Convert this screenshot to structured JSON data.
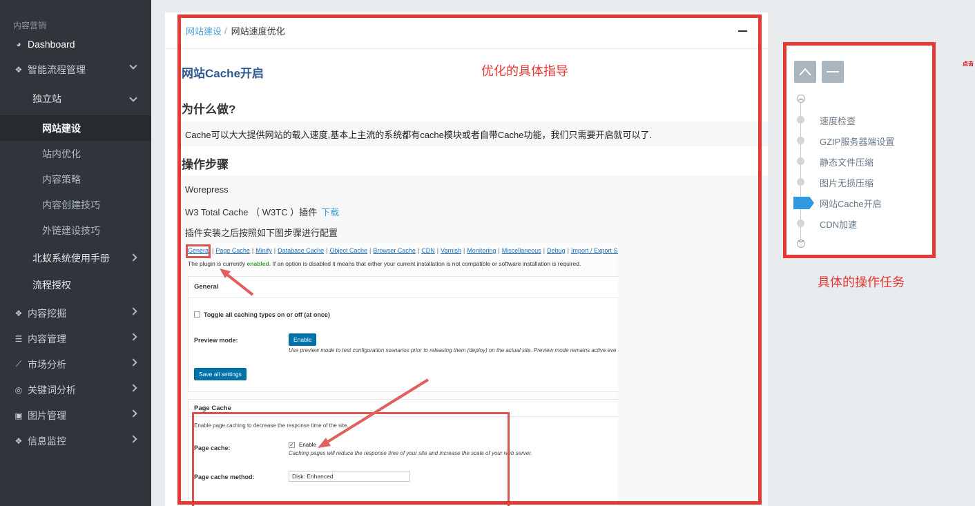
{
  "sidebar": {
    "section_title": "内容营销",
    "items": [
      {
        "label": "Dashboard",
        "icon": "dashboard-icon"
      },
      {
        "label": "智能流程管理",
        "icon": "cubes-icon"
      },
      {
        "label": "独立站"
      },
      {
        "label": "网站建设"
      },
      {
        "label": "站内优化"
      },
      {
        "label": "内容策略"
      },
      {
        "label": "内容创建技巧"
      },
      {
        "label": "外链建设技巧"
      },
      {
        "label": "北蚁系统使用手册"
      },
      {
        "label": "流程授权"
      },
      {
        "label": "内容挖掘",
        "icon": "cubes-icon"
      },
      {
        "label": "内容管理",
        "icon": "list-icon"
      },
      {
        "label": "市场分析",
        "icon": "chart-icon"
      },
      {
        "label": "关键词分析",
        "icon": "target-icon"
      },
      {
        "label": "图片管理",
        "icon": "image-icon"
      },
      {
        "label": "信息监控",
        "icon": "cubes-icon"
      }
    ]
  },
  "breadcrumb": {
    "parent": "网站建设",
    "separator": "/",
    "current": "网站速度优化"
  },
  "content": {
    "title": "网站Cache开启",
    "why_heading": "为什么做?",
    "why_text": "Cache可以大大提供网站的载入速度,基本上主流的系统都有cache模块或者自带Cache功能，我们只需要开启就可以了.",
    "steps_heading": "操作步骤",
    "step1": "Worepress",
    "step2": "W3 Total Cache （ W3TC ）插件",
    "step2_link": "下载",
    "step3": "插件安装之后按照如下图步骤进行配置"
  },
  "screenshot": {
    "tabs": [
      "General",
      "Page Cache",
      "Minify",
      "Database Cache",
      "Object Cache",
      "Browser Cache",
      "CDN",
      "Varnish",
      "Monitoring",
      "Miscellaneous",
      "Debug",
      "Import / Export Settings"
    ],
    "note_pre": "The plugin is currently",
    "note_bold": "enabled.",
    "note_post": "If an option is disabled it means that either your current installation is not compatible or software installation is required.",
    "general_title": "General",
    "toggle_label": "Toggle all caching types on or off (at once)",
    "preview_label": "Preview mode:",
    "enable_btn": "Enable",
    "preview_desc": "Use preview mode to test configuration scenarios prior to releasing them (deploy) on the actual site. Preview mode remains active eve",
    "save_btn": "Save all settings",
    "pc_title": "Page Cache",
    "pc_desc": "Enable page caching to decrease the response time of the site.",
    "pc_label": "Page cache:",
    "pc_enable": "Enable",
    "pc_enable_desc": "Caching pages will reduce the response time of your site and increase the scale of your web server.",
    "pc_method_label": "Page cache method:",
    "pc_method_value": "Disk: Enhanced"
  },
  "annotations": {
    "guide": "优化的具体指导",
    "tasks": "具体的操作任务"
  },
  "tasks": {
    "items": [
      "速度检查",
      "GZIP服务器端设置",
      "静态文件压缩",
      "图片无损压缩",
      "网站Cache开启",
      "CDN加速"
    ],
    "active_index": 4
  },
  "corner": {
    "text": "点击"
  },
  "colors": {
    "accent": "#4a9ed8",
    "red": "#e53935",
    "sidebar": "#2f353b",
    "active_task": "#2f9ae0"
  }
}
